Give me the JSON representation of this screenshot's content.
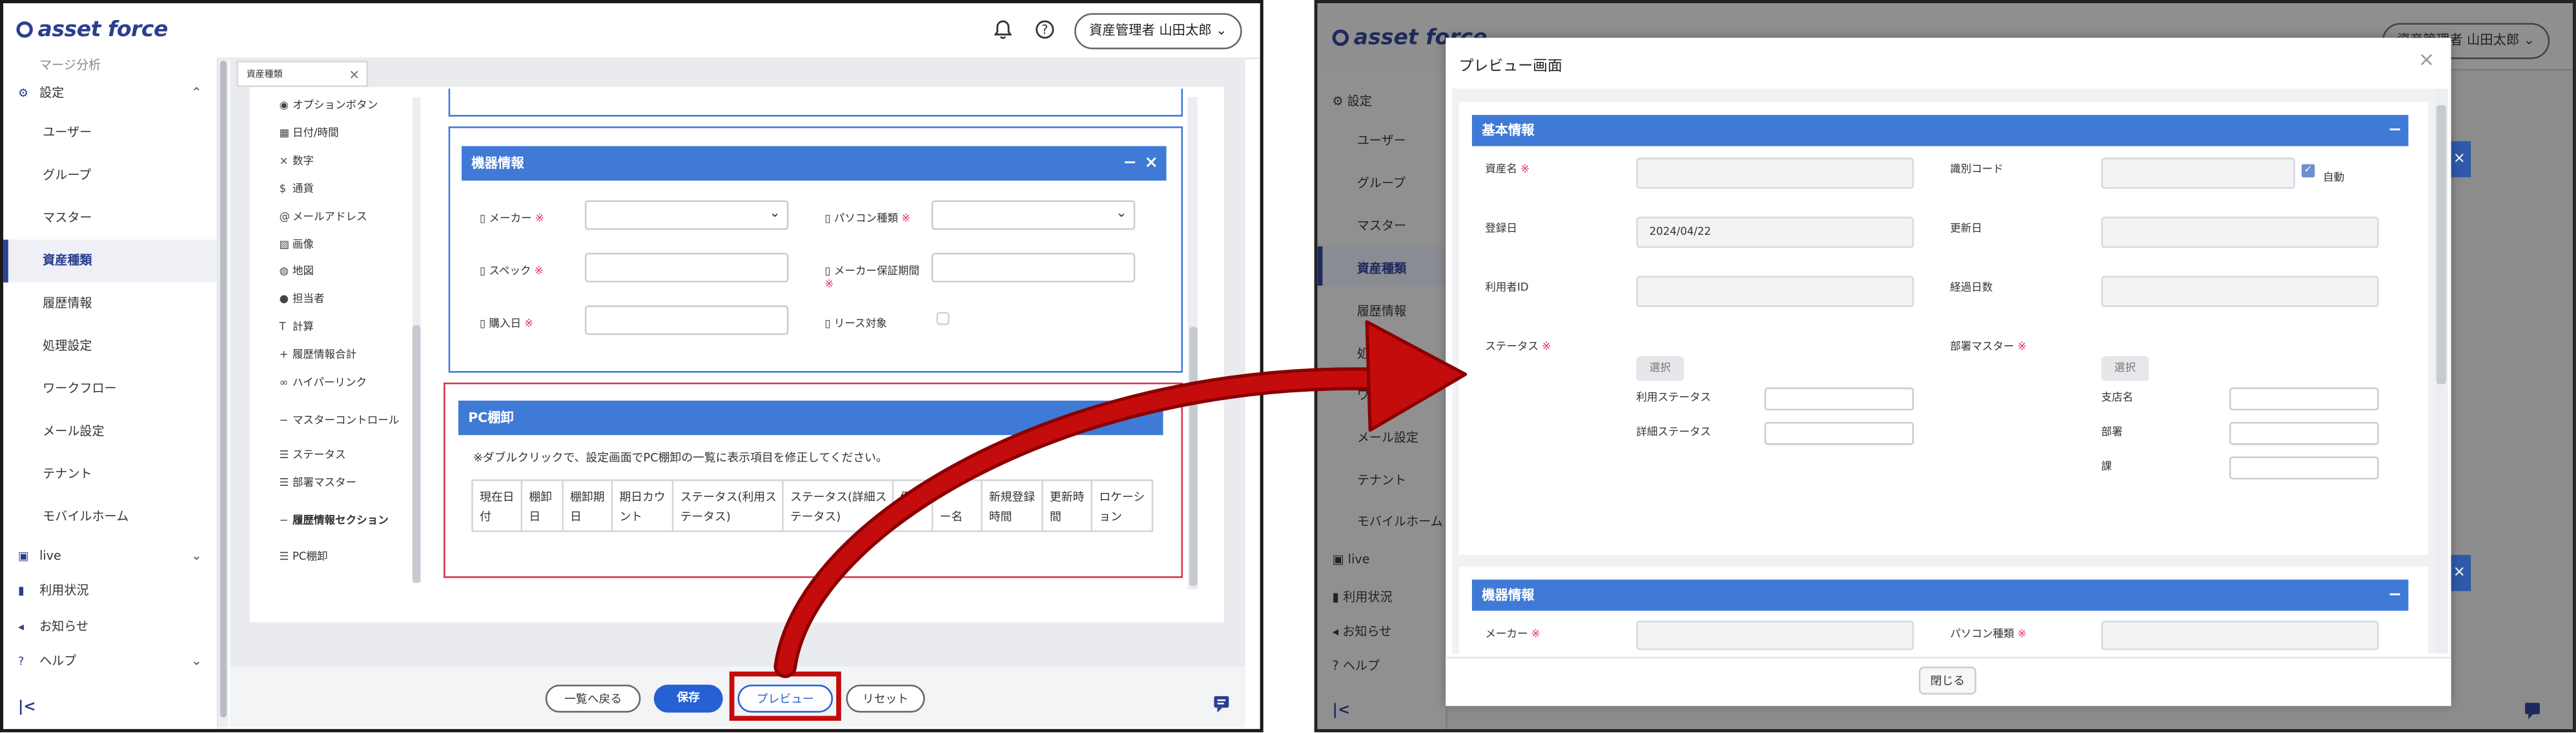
{
  "app": {
    "logo": "asset force"
  },
  "header": {
    "user_menu": "資産管理者 山田太郎"
  },
  "icons": {
    "bell": "bell-icon",
    "help": "help-circle-icon",
    "arrow": "red-curved-arrow",
    "colors": {
      "brand": "#2b3f8f",
      "section": "#3f7ad6",
      "required": "#e0335a",
      "arrow": "#c40c0c"
    }
  },
  "sidebar": {
    "cut_top": "マージ分析",
    "settings": "設定",
    "items": [
      "ユーザー",
      "グループ",
      "マスター",
      "資産種類",
      "履歴情報",
      "処理設定",
      "ワークフロー",
      "メール設定",
      "テナント",
      "モバイルホーム"
    ],
    "live": "live",
    "usage": "利用状況",
    "notice": "お知らせ",
    "help": "ヘルプ",
    "collapse": "|<"
  },
  "editor": {
    "tab": "資産種類",
    "palette": [
      "オプションボタン",
      "日付/時間",
      "数字",
      "通貨",
      "メールアドレス",
      "画像",
      "地図",
      "担当者",
      "計算",
      "履歴情報合計",
      "ハイパーリンク"
    ],
    "palette_sections": {
      "master_control": "マスターコントロール",
      "master_items": [
        "ステータス",
        "部署マスター"
      ],
      "history_section": "履歴情報セクション",
      "history_items": [
        "PC棚卸"
      ]
    },
    "device": {
      "title": "機器情報",
      "fields": {
        "maker": "メーカー",
        "pc_type": "パソコン種類",
        "spec": "スペック",
        "maker_warranty": "メーカー保証期間",
        "purchase": "購入日",
        "lease": "リース対象"
      }
    },
    "pc": {
      "title": "PC棚卸",
      "note": "※ダブルクリックで、設定画面でPC棚卸の一覧に表示項目を修正してください。",
      "columns": [
        "現在日付",
        "棚卸日",
        "棚卸期日",
        "期日カウント",
        "ステータス(利用ステータス)",
        "ステータス(詳細ステータス)",
        "備",
        "ー名",
        "新規登録時間",
        "更新時間",
        "ロケーション"
      ]
    },
    "buttons": {
      "back": "一覧へ戻る",
      "save": "保存",
      "preview": "プレビュー",
      "reset": "リセット"
    }
  },
  "preview": {
    "title": "プレビュー画面",
    "basic": {
      "title": "基本情報",
      "asset_name": "資産名",
      "id_code": "識別コード",
      "auto": "自動",
      "registered": "登録日",
      "registered_value": "2024/04/22",
      "updated": "更新日",
      "user_id": "利用者ID",
      "elapsed": "経過日数",
      "status": "ステータス",
      "select": "選択",
      "use_status": "利用ステータス",
      "detail_status": "詳細ステータス",
      "dept_master": "部署マスター",
      "branch": "支店名",
      "dept": "部署",
      "section": "課"
    },
    "device": {
      "title": "機器情報",
      "maker": "メーカー",
      "pc_type": "パソコン種類"
    },
    "close": "閉じる"
  }
}
